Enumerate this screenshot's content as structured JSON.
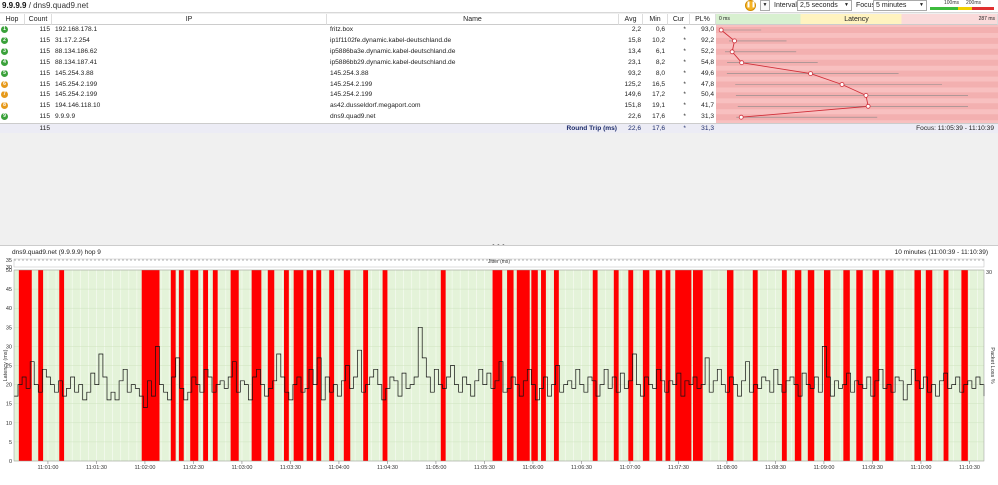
{
  "window": {
    "title_bold": "9.9.9.9",
    "title_rest": " / dns9.quad9.net"
  },
  "toolbar": {
    "interval_label": "Interval",
    "interval_value": "2,5 seconds",
    "focus_label": "Focus",
    "focus_value": "5 minutes",
    "legend": {
      "l1": "100ms",
      "l2": "200ms"
    }
  },
  "columns": {
    "hop": "Hop",
    "count": "Count",
    "ip": "IP",
    "name": "Name",
    "avg": "Avg",
    "min": "Min",
    "cur": "Cur",
    "pl": "PL%",
    "lat_min": "0 ms",
    "latency": "Latency",
    "lat_max": "287 ms"
  },
  "rows": [
    {
      "hop": "1",
      "count": "115",
      "ip": "192.168.178.1",
      "name": "fritz.box",
      "avg": "2,2",
      "min": "0,6",
      "cur": "*",
      "pl": "93,0",
      "color": "#3aa13a"
    },
    {
      "hop": "2",
      "count": "115",
      "ip": "31.17.2.254",
      "name": "ip1f1102fe.dynamic.kabel-deutschland.de",
      "avg": "15,8",
      "min": "10,2",
      "cur": "*",
      "pl": "92,2",
      "color": "#3aa13a"
    },
    {
      "hop": "3",
      "count": "115",
      "ip": "88.134.186.62",
      "name": "ip5886ba3e.dynamic.kabel-deutschland.de",
      "avg": "13,4",
      "min": "6,1",
      "cur": "*",
      "pl": "52,2",
      "color": "#3aa13a"
    },
    {
      "hop": "4",
      "count": "115",
      "ip": "88.134.187.41",
      "name": "ip5886bb29.dynamic.kabel-deutschland.de",
      "avg": "23,1",
      "min": "8,2",
      "cur": "*",
      "pl": "54,8",
      "color": "#3aa13a"
    },
    {
      "hop": "5",
      "count": "115",
      "ip": "145.254.3.88",
      "name": "145.254.3.88",
      "avg": "93,2",
      "min": "8,0",
      "cur": "*",
      "pl": "49,6",
      "color": "#3aa13a"
    },
    {
      "hop": "6",
      "count": "115",
      "ip": "145.254.2.199",
      "name": "145.254.2.199",
      "avg": "125,2",
      "min": "16,5",
      "cur": "*",
      "pl": "47,8",
      "color": "#e69a1c"
    },
    {
      "hop": "7",
      "count": "115",
      "ip": "145.254.2.199",
      "name": "145.254.2.199",
      "avg": "149,6",
      "min": "17,2",
      "cur": "*",
      "pl": "50,4",
      "color": "#e69a1c"
    },
    {
      "hop": "8",
      "count": "115",
      "ip": "194.146.118.10",
      "name": "as42.dusseldorf.megaport.com",
      "avg": "151,8",
      "min": "19,1",
      "cur": "*",
      "pl": "41,7",
      "color": "#e69a1c"
    },
    {
      "hop": "9",
      "count": "115",
      "ip": "9.9.9.9",
      "name": "dns9.quad9.net",
      "avg": "22,6",
      "min": "17,6",
      "cur": "*",
      "pl": "31,3",
      "color": "#3aa13a"
    }
  ],
  "summary": {
    "count": "115",
    "label": "Round Trip (ms)",
    "avg": "22,6",
    "min": "17,6",
    "cur": "*",
    "pl": "31,3",
    "focus": "Focus: 11:05:39 - 11:10:39"
  },
  "grip": "• • •",
  "chart_data": {
    "type": "line",
    "title": "dns9.quad9.net (9.9.9.9) hop 9",
    "range_label": "10 minutes (11:00:39 - 11:10:39)",
    "top_axis": {
      "labels": [
        "35",
        "30"
      ],
      "jitter_label": "Jitter (ms)"
    },
    "ylabel": "Latency (ms)",
    "y2label": "Packet Loss %",
    "ylim": [
      0,
      50
    ],
    "y_ticks": [
      "0",
      "5",
      "10",
      "15",
      "20",
      "25",
      "30",
      "35",
      "40",
      "45",
      "50"
    ],
    "y2_top": "30",
    "x_ticks": [
      "11:01:00",
      "11:01:30",
      "11:02:00",
      "11:02:30",
      "11:03:00",
      "11:03:30",
      "11:04:00",
      "11:04:30",
      "11:05:00",
      "11:05:30",
      "11:06:00",
      "11:06:30",
      "11:07:00",
      "11:07:30",
      "11:08:00",
      "11:08:30",
      "11:09:00",
      "11:09:30",
      "11:10:00",
      "11:10:30"
    ],
    "x_start_sec": 39,
    "x_end_sec": 639,
    "sample_interval_sec": 2.5,
    "loss_intervals_sec": [
      [
        42,
        50
      ],
      [
        54,
        57
      ],
      [
        67,
        70
      ],
      [
        118,
        129
      ],
      [
        136,
        139
      ],
      [
        141,
        144
      ],
      [
        148,
        153
      ],
      [
        156,
        159
      ],
      [
        162,
        165
      ],
      [
        173,
        178
      ],
      [
        186,
        192
      ],
      [
        196,
        200
      ],
      [
        206,
        209
      ],
      [
        212,
        218
      ],
      [
        220,
        224
      ],
      [
        226,
        229
      ],
      [
        234,
        237
      ],
      [
        243,
        247
      ],
      [
        255,
        258
      ],
      [
        267,
        270
      ],
      [
        303,
        306
      ],
      [
        335,
        341
      ],
      [
        344,
        348
      ],
      [
        350,
        358
      ],
      [
        359,
        363
      ],
      [
        365,
        368
      ],
      [
        373,
        376
      ],
      [
        397,
        400
      ],
      [
        410,
        413
      ],
      [
        419,
        422
      ],
      [
        428,
        432
      ],
      [
        436,
        440
      ],
      [
        442,
        445
      ],
      [
        448,
        458
      ],
      [
        459,
        465
      ],
      [
        480,
        484
      ],
      [
        496,
        499
      ],
      [
        514,
        517
      ],
      [
        522,
        526
      ],
      [
        530,
        534
      ],
      [
        540,
        544
      ],
      [
        552,
        556
      ],
      [
        560,
        564
      ],
      [
        570,
        574
      ],
      [
        578,
        583
      ],
      [
        596,
        600
      ],
      [
        603,
        607
      ],
      [
        614,
        617
      ],
      [
        625,
        629
      ]
    ],
    "latency_ms": [
      17,
      20,
      22,
      19,
      26,
      20,
      18,
      24,
      22,
      20,
      18,
      21,
      17,
      19,
      22,
      18,
      20,
      16,
      18,
      23,
      20,
      28,
      22,
      16,
      18,
      16,
      21,
      24,
      18,
      20,
      19,
      17,
      14,
      21,
      17,
      30,
      20,
      18,
      16,
      22,
      27,
      19,
      16,
      18,
      22,
      20,
      18,
      24,
      22,
      18,
      20,
      21,
      19,
      22,
      26,
      18,
      21,
      20,
      16,
      22,
      24,
      20,
      17,
      19,
      21,
      28,
      22,
      18,
      16,
      20,
      22,
      18,
      19,
      24,
      20,
      27,
      16,
      22,
      18,
      20,
      17,
      21,
      25,
      19,
      22,
      29,
      18,
      20,
      22,
      24,
      20,
      16,
      19,
      22,
      21,
      17,
      23,
      19,
      20,
      22,
      35,
      27,
      22,
      18,
      24,
      20,
      19,
      22,
      25,
      20,
      18,
      22,
      20,
      17,
      21,
      24,
      20,
      23,
      19,
      21,
      26,
      18,
      19,
      22,
      20,
      17,
      21,
      24,
      20,
      16,
      19,
      22,
      17,
      20,
      25,
      18,
      20,
      21,
      19,
      24,
      20,
      18,
      22,
      21,
      17,
      20,
      24,
      19,
      22,
      18,
      23,
      19,
      21,
      28,
      20,
      17,
      22,
      20,
      19,
      24,
      21,
      18,
      21,
      20,
      23,
      17,
      21,
      20,
      22,
      19,
      20,
      27,
      18,
      21,
      24,
      20,
      18,
      22,
      20,
      17,
      21,
      26,
      18,
      20,
      19,
      22,
      21,
      18,
      24,
      20,
      18,
      21,
      22,
      20,
      17,
      23,
      20,
      19,
      22,
      18,
      30,
      22,
      17,
      21,
      19,
      20,
      23,
      18,
      21,
      20,
      19,
      22,
      17,
      21,
      24,
      19,
      20,
      18,
      22,
      21,
      16,
      20,
      24,
      21,
      19,
      22,
      18,
      20,
      17,
      21,
      23,
      19,
      20,
      22,
      18,
      20,
      21,
      19,
      22,
      20,
      17
    ]
  }
}
